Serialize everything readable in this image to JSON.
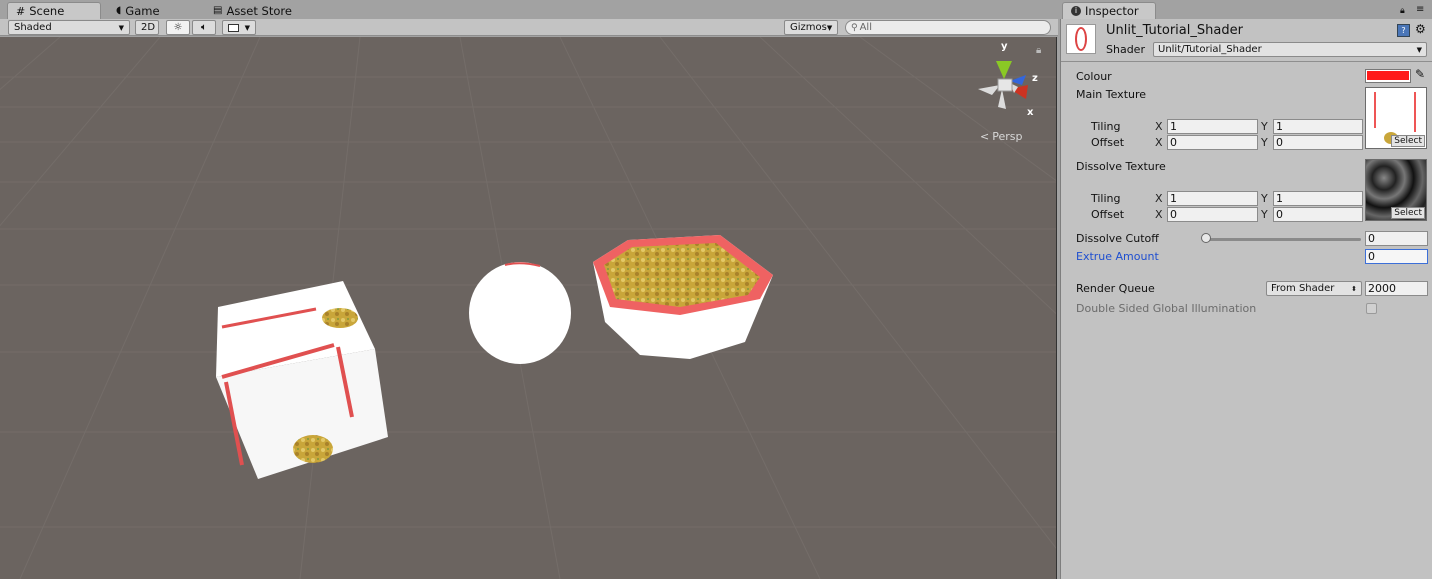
{
  "scene_tabs": {
    "scene": "Scene",
    "game": "Game",
    "asset_store": "Asset Store"
  },
  "scene_toolbar": {
    "shading_mode": "Shaded",
    "mode_2d": "2D",
    "gizmos": "Gizmos",
    "search_placeholder": "All"
  },
  "gizmo": {
    "axis_y": "y",
    "axis_z": "z",
    "axis_x": "x",
    "projection": "Persp"
  },
  "inspector": {
    "tab_title": "Inspector",
    "material_name": "Unlit_Tutorial_Shader",
    "shader_label": "Shader",
    "shader_value": "Unlit/Tutorial_Shader",
    "colour_label": "Colour",
    "colour_value": "#ff1a1a",
    "main_texture_label": "Main Texture",
    "tiling_label": "Tiling",
    "offset_label": "Offset",
    "x": "X",
    "y": "Y",
    "main_tiling_x": "1",
    "main_tiling_y": "1",
    "main_offset_x": "0",
    "main_offset_y": "0",
    "select": "Select",
    "dissolve_texture_label": "Dissolve Texture",
    "dissolve_tiling_x": "1",
    "dissolve_tiling_y": "1",
    "dissolve_offset_x": "0",
    "dissolve_offset_y": "0",
    "dissolve_cutoff_label": "Dissolve Cutoff",
    "dissolve_cutoff_value": "0",
    "extrue_amount_label": "Extrue Amount",
    "extrue_amount_value": "0",
    "render_queue_label": "Render Queue",
    "render_queue_mode": "From Shader",
    "render_queue_value": "2000",
    "double_sided_gi_label": "Double Sided Global Illumination"
  }
}
